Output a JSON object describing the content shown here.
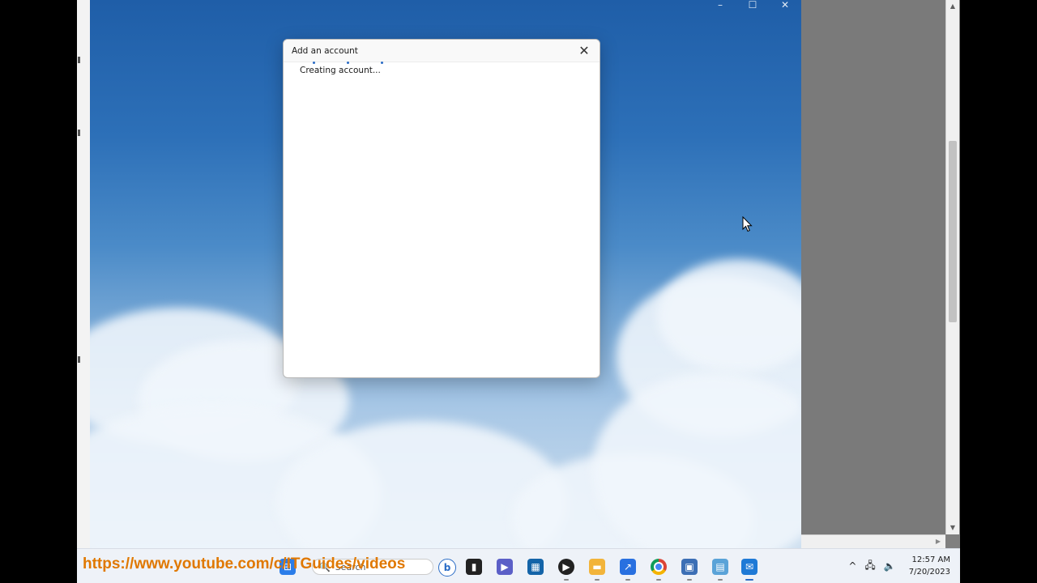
{
  "dialog": {
    "title": "Add an account",
    "status": "Creating account..."
  },
  "window_controls": {
    "minimize": "–",
    "maximize": "☐",
    "close": "✕"
  },
  "overlay": {
    "url": "https://www.youtube.com/c/ITGuides/videos"
  },
  "taskbar": {
    "search_placeholder": "Search",
    "icons": [
      "windows-start-icon",
      "search-icon",
      "bing-icon",
      "task-view-icon",
      "teams-chat-icon",
      "store-icon",
      "media-player-icon",
      "file-explorer-icon",
      "power-automate-icon",
      "chrome-icon",
      "remote-desktop-icon",
      "control-panel-icon",
      "mail-icon"
    ],
    "clock_time": "12:57 AM",
    "clock_date": "7/20/2023"
  },
  "colors": {
    "accent": "#2a6cc6",
    "overlay_text": "#e07800"
  }
}
